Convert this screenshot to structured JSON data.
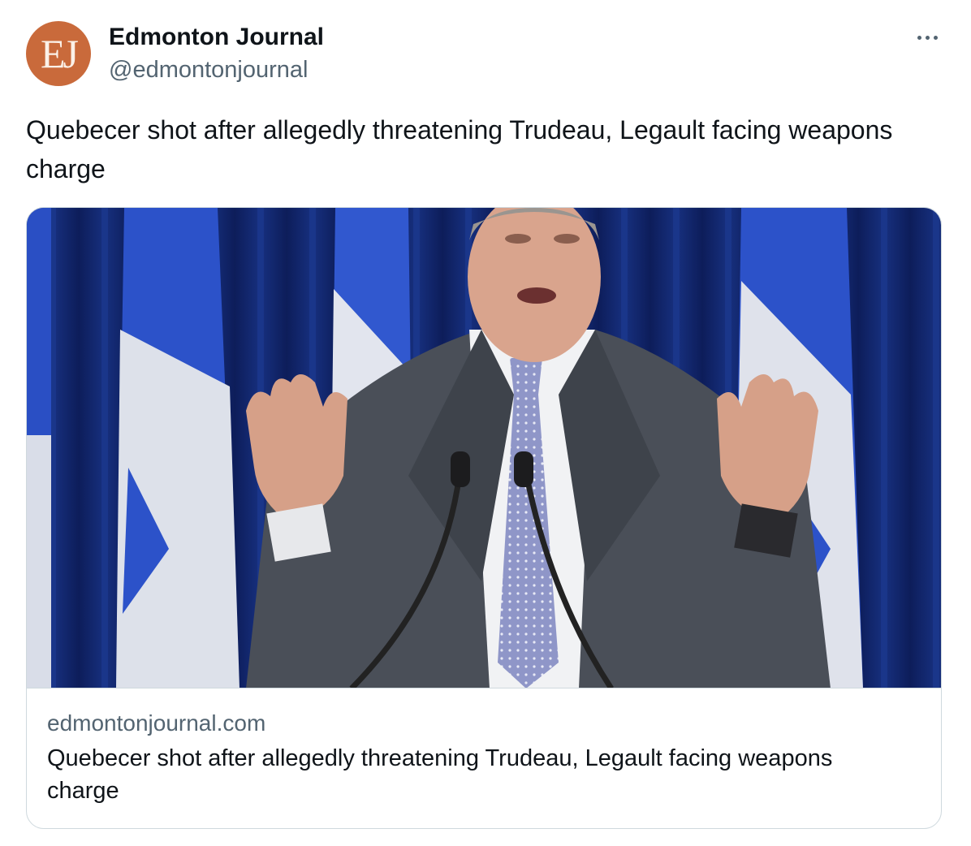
{
  "account": {
    "avatar_text": "EJ",
    "display_name": "Edmonton Journal",
    "handle": "@edmontonjournal"
  },
  "tweet": {
    "text": "Quebecer shot after allegedly threatening Trudeau, Legault facing weapons charge"
  },
  "link_card": {
    "domain": "edmontonjournal.com",
    "title": "Quebecer shot after allegedly threatening Trudeau, Legault facing weapons charge",
    "image_icon": "press-conference-photo"
  },
  "icons": {
    "more": "more-options-icon"
  },
  "colors": {
    "avatar_bg": "#c96a3b",
    "text_primary": "#0f1419",
    "text_secondary": "#536471",
    "border": "#cfd9de"
  }
}
